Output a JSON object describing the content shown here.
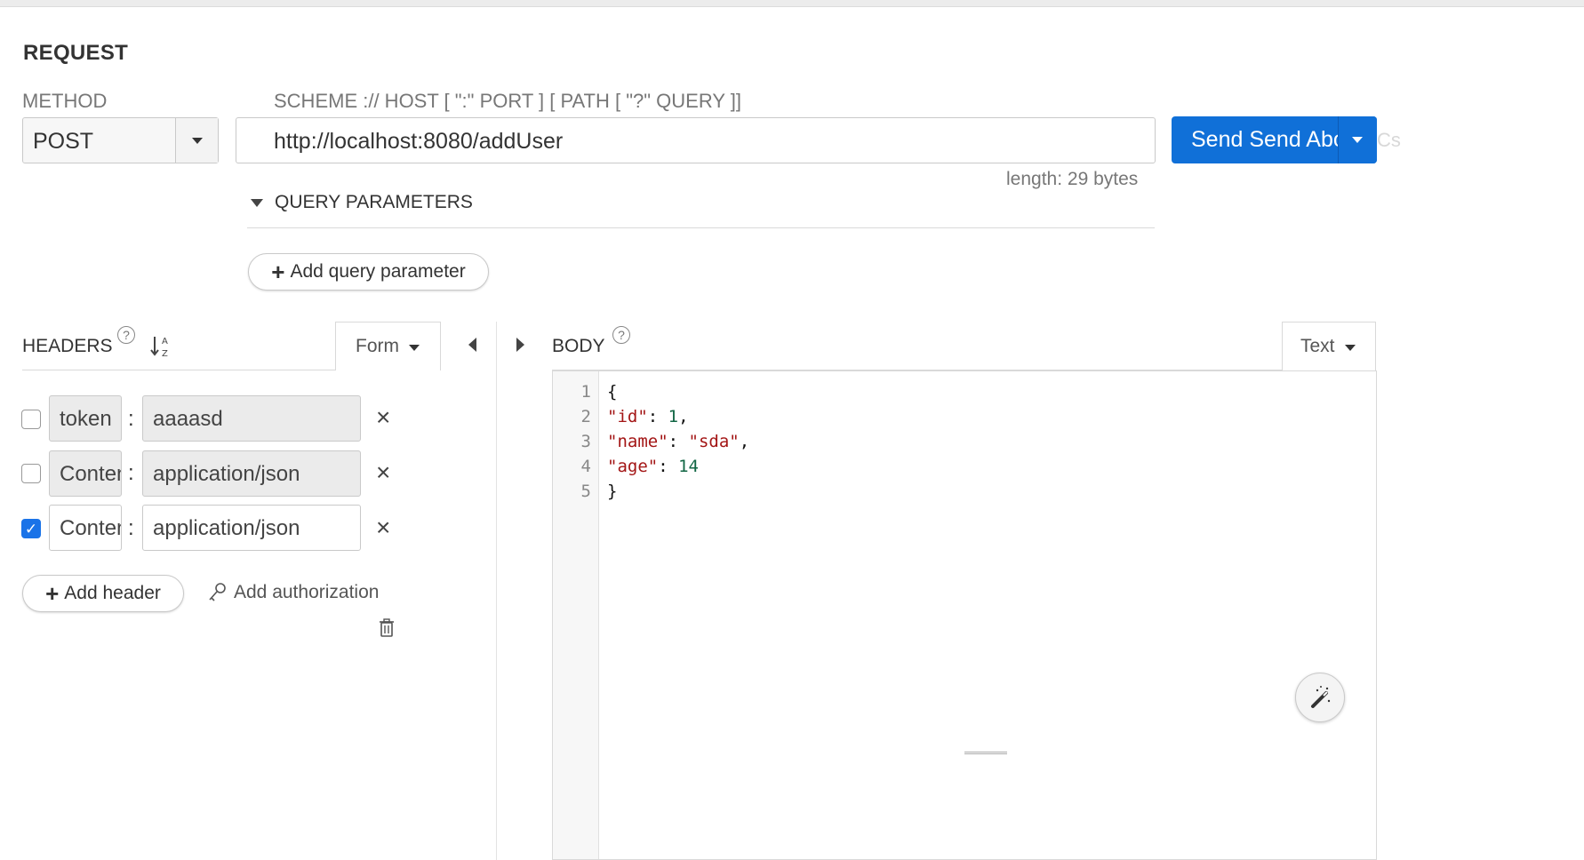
{
  "request": {
    "title": "REQUEST",
    "method_label": "METHOD",
    "method_value": "POST",
    "url_label": "SCHEME :// HOST [ \":\" PORT ] [ PATH [ \"?\" QUERY ]]",
    "url_value": "http://localhost:8080/addUser",
    "send_label": "Send Send Abort",
    "length_text": "length: 29 bytes",
    "query_params_label": "QUERY PARAMETERS",
    "add_query_param_label": "Add query parameter",
    "accent_color": "#1070d8"
  },
  "headers": {
    "label": "HEADERS",
    "help_glyph": "?",
    "mode": "Form",
    "rows": [
      {
        "checked": false,
        "name": "token",
        "value": "aaaasd",
        "enabled": false
      },
      {
        "checked": false,
        "name": "Content-Type",
        "value": "application/json",
        "enabled": false
      },
      {
        "checked": true,
        "name": "Content-Type",
        "value": "application/json",
        "enabled": true
      }
    ],
    "colon": ":",
    "remove_glyph": "×",
    "add_header_label": "Add header",
    "add_auth_label": "Add authorization"
  },
  "body": {
    "label": "BODY",
    "help_glyph": "?",
    "mode": "Text",
    "line_numbers": [
      "1",
      "2",
      "3",
      "4",
      "5"
    ],
    "code": {
      "l1": "{",
      "l2_key": "\"id\"",
      "l2_sep": ": ",
      "l2_val": "1",
      "l2_end": ",",
      "l3_key": "\"name\"",
      "l3_sep": ": ",
      "l3_val": "\"sda\"",
      "l3_end": ",",
      "l4_key": "\"age\"",
      "l4_sep": ": ",
      "l4_val": "14",
      "l5": "}"
    }
  }
}
